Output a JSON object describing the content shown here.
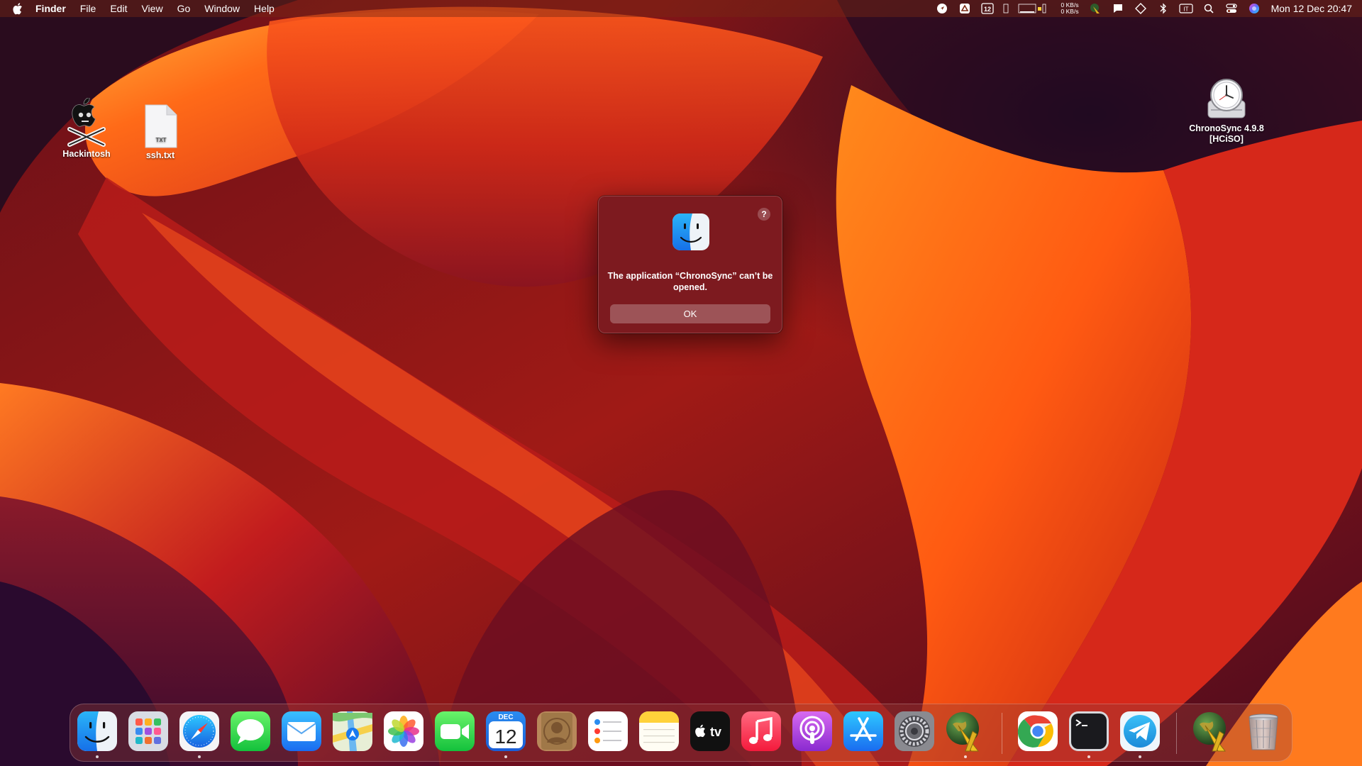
{
  "menubar": {
    "app_name": "Finder",
    "menus": [
      "File",
      "Edit",
      "View",
      "Go",
      "Window",
      "Help"
    ],
    "calendar_badge": "12",
    "network_up": "0 KB/s",
    "network_down": "0 KB/s",
    "input_source": "IT",
    "clock": "Mon 12 Dec  20:47"
  },
  "desktop": {
    "icons": [
      {
        "label": "Hackintosh",
        "icon": "hackintosh-pirate-apple-icon"
      },
      {
        "label": "ssh.txt",
        "icon": "text-file-icon",
        "badge": "TXT"
      },
      {
        "label": "ChronoSync 4.9.8 [HCiSO]",
        "icon": "disk-image-clock-icon"
      }
    ]
  },
  "dialog": {
    "help_label": "?",
    "message": "The application “ChronoSync” can’t be opened.",
    "ok_label": "OK"
  },
  "dock": {
    "calendar_month": "DEC",
    "calendar_day": "12",
    "tv_label": "tv",
    "items": [
      "Finder",
      "Launchpad",
      "Safari",
      "Messages",
      "Mail",
      "Maps",
      "Photos",
      "FaceTime",
      "Calendar",
      "Contacts",
      "Reminders",
      "Notes",
      "Apple TV",
      "Music",
      "Podcasts",
      "App Store",
      "System Settings",
      "OpenCore Configurator",
      "Google Chrome",
      "Terminal",
      "Telegram",
      "OpenCore Configurator",
      "Trash"
    ]
  },
  "colors": {
    "dialog_bg": "#7d1a1f",
    "menubar_bg": "#7a2814",
    "accent_orange": "#ff6a1a"
  }
}
